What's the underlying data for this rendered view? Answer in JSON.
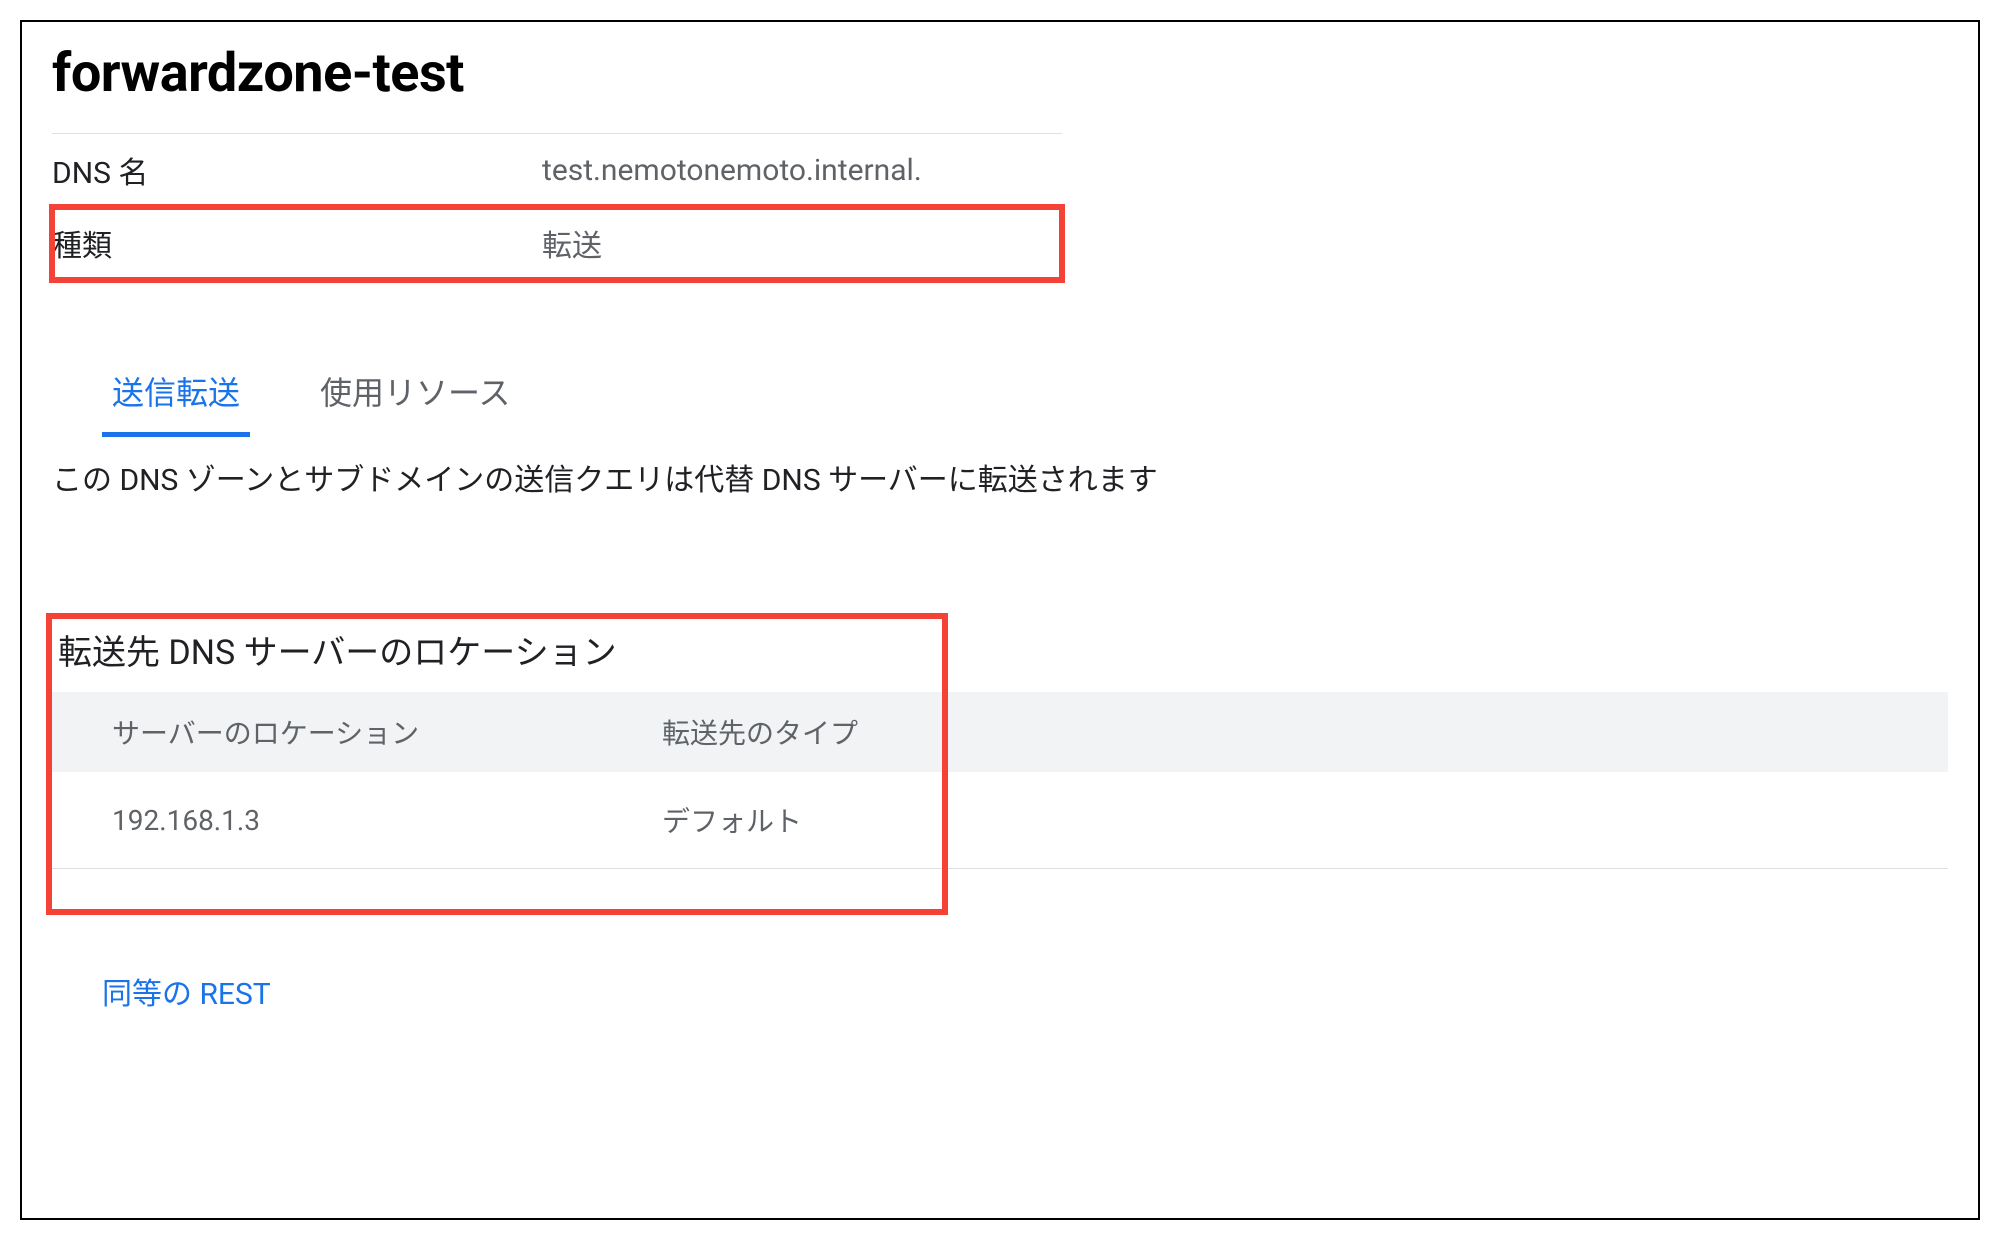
{
  "header": {
    "title": "forwardzone-test"
  },
  "properties": {
    "rows": [
      {
        "label": "DNS 名",
        "value": "test.nemotonemoto.internal.",
        "highlighted": false
      },
      {
        "label": "種類",
        "value": "転送",
        "highlighted": true
      }
    ]
  },
  "tabs": {
    "items": [
      {
        "label": "送信転送",
        "active": true
      },
      {
        "label": "使用リソース",
        "active": false
      }
    ]
  },
  "description": "この DNS ゾーンとサブドメインの送信クエリは代替 DNS サーバーに転送されます",
  "forwarding_section": {
    "title": "転送先 DNS サーバーのロケーション",
    "highlighted": true,
    "columns": [
      "サーバーのロケーション",
      "転送先のタイプ"
    ],
    "rows": [
      {
        "location": "192.168.1.3",
        "type": "デフォルト"
      }
    ]
  },
  "footer": {
    "rest_link_label": "同等の REST"
  },
  "colors": {
    "accent": "#1a73e8",
    "highlight_border": "#f44336",
    "muted_text": "#5f6368"
  }
}
